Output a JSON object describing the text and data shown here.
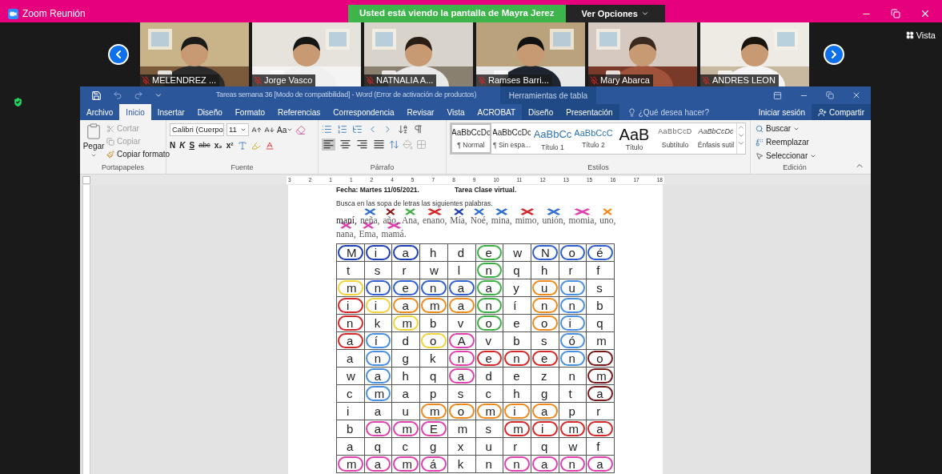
{
  "zoom": {
    "title": "Zoom Reunión",
    "banner": "Usted está viendo la pantalla de Mayra Jerez",
    "view_options": "Ver Opciones",
    "view_button": "Vista"
  },
  "participants": [
    {
      "name": "MELENDREZ ...",
      "muted": true
    },
    {
      "name": "Jorge Vasco",
      "muted": true
    },
    {
      "name": "NATNALIA A...",
      "muted": true
    },
    {
      "name": "Ramses Barri...",
      "muted": true
    },
    {
      "name": "Mary Abarca",
      "muted": true
    },
    {
      "name": "ANDRES LEON",
      "muted": true
    }
  ],
  "word": {
    "title": "Tareas semana 36 [Modo de compatibilidad] - Word (Error de activación de productos)",
    "context_group": "Herramientas de tabla",
    "tabs": [
      {
        "label": "Archivo",
        "selected": false,
        "kind": "main"
      },
      {
        "label": "Inicio",
        "selected": true,
        "kind": "main"
      },
      {
        "label": "Insertar",
        "selected": false,
        "kind": "main"
      },
      {
        "label": "Diseño",
        "selected": false,
        "kind": "main"
      },
      {
        "label": "Formato",
        "selected": false,
        "kind": "main"
      },
      {
        "label": "Referencias",
        "selected": false,
        "kind": "main"
      },
      {
        "label": "Correspondencia",
        "selected": false,
        "kind": "main"
      },
      {
        "label": "Revisar",
        "selected": false,
        "kind": "main"
      },
      {
        "label": "Vista",
        "selected": false,
        "kind": "main"
      },
      {
        "label": "ACROBAT",
        "selected": false,
        "kind": "main"
      },
      {
        "label": "Diseño",
        "selected": false,
        "kind": "context"
      },
      {
        "label": "Presentación",
        "selected": false,
        "kind": "context"
      }
    ],
    "tell_me": "¿Qué desea hacer?",
    "sign_in": "Iniciar sesión",
    "share": "Compartir",
    "clipboard": {
      "group": "Portapapeles",
      "paste": "Pegar",
      "cut": {
        "label": "Cortar",
        "disabled": true
      },
      "copy": {
        "label": "Copiar",
        "disabled": true
      },
      "format_painter": {
        "label": "Copiar formato",
        "disabled": false
      }
    },
    "font": {
      "group": "Fuente",
      "name": "Calibri (Cuerpo",
      "size": "11",
      "change_case": "Aa",
      "bold": "N",
      "italic": "K",
      "underline": "S",
      "strikethrough": "abc",
      "subscript": "x₂",
      "superscript": "x²"
    },
    "paragraph": {
      "group": "Párrafo",
      "alignments": [
        {
          "kind": "left",
          "selected": true
        },
        {
          "kind": "center",
          "selected": false
        },
        {
          "kind": "right",
          "selected": false
        },
        {
          "kind": "justify",
          "selected": false
        }
      ]
    },
    "styles": {
      "group": "Estilos",
      "items": [
        {
          "sample": "AaBbCcDc",
          "label": "¶ Normal",
          "kind": "normal",
          "selected": true
        },
        {
          "sample": "AaBbCcDc",
          "label": "¶ Sin espa...",
          "kind": "normal",
          "selected": false
        },
        {
          "sample": "AaBbCc",
          "label": "Título 1",
          "kind": "heading1",
          "selected": false
        },
        {
          "sample": "AaBbCcC",
          "label": "Título 2",
          "kind": "heading2",
          "selected": false
        },
        {
          "sample": "AaB",
          "label": "Título",
          "kind": "title",
          "selected": false
        },
        {
          "sample": "AaBbCcD",
          "label": "Subtítulo",
          "kind": "subtitle",
          "selected": false
        },
        {
          "sample": "AaBbCcDc",
          "label": "Énfasis sutil",
          "kind": "emphasis",
          "selected": false
        }
      ]
    },
    "editing": {
      "group": "Edición",
      "find": "Buscar",
      "replace": "Reemplazar",
      "select": "Seleccionar"
    },
    "ruler": [
      "3",
      "2",
      "1",
      "1",
      "2",
      "4",
      "5",
      "7",
      "8",
      "9",
      "10",
      "11",
      "12",
      "13",
      "15",
      "16",
      "17",
      "18"
    ],
    "document": {
      "date": "Fecha: Martes 11/05/2021.",
      "task": "Tarea Clase virtual.",
      "instruction": "Busca en las sopa de letras las siguientes palabras.",
      "word_lines": [
        [
          {
            "text": "maní,",
            "crossed": false
          },
          {
            "text": "neña,",
            "crossed": true,
            "color": "#2f6fd6"
          },
          {
            "text": "año,",
            "crossed": true,
            "color": "#8b1a1a"
          },
          {
            "text": "Ana,",
            "crossed": true,
            "color": "#3cb043"
          },
          {
            "text": "enano,",
            "crossed": true,
            "color": "#d62828"
          },
          {
            "text": "Mía,",
            "crossed": true,
            "color": "#1d3fb8"
          },
          {
            "text": "Noé,",
            "crossed": true,
            "color": "#2f6fd6"
          },
          {
            "text": "mina,",
            "crossed": true,
            "color": "#2f6fd6"
          },
          {
            "text": "mimo,",
            "crossed": true,
            "color": "#d62828"
          },
          {
            "text": "unión,",
            "crossed": true,
            "color": "#2f6fd6"
          },
          {
            "text": "momia,",
            "crossed": true,
            "color": "#e040b0"
          },
          {
            "text": "uno,",
            "crossed": true,
            "color": "#f08a1c"
          }
        ],
        [
          {
            "text": "nana,",
            "crossed": true,
            "color": "#e040b0"
          },
          {
            "text": "Ema,",
            "crossed": true,
            "color": "#e040b0"
          },
          {
            "text": "mamá.",
            "crossed": true,
            "color": "#e040b0"
          }
        ]
      ],
      "grid": [
        [
          {
            "letter": "M",
            "color": "#1d3fb8"
          },
          {
            "letter": "i",
            "color": "#1d3fb8"
          },
          {
            "letter": "a",
            "color": "#1d3fb8"
          },
          {
            "letter": "h"
          },
          {
            "letter": "d"
          },
          {
            "letter": "e",
            "color": "#3cb043"
          },
          {
            "letter": "w"
          },
          {
            "letter": "N",
            "color": "#2f5fd0"
          },
          {
            "letter": "o",
            "color": "#2f5fd0"
          },
          {
            "letter": "é",
            "color": "#2f5fd0"
          }
        ],
        [
          {
            "letter": "t"
          },
          {
            "letter": "s"
          },
          {
            "letter": "r"
          },
          {
            "letter": "w"
          },
          {
            "letter": "l"
          },
          {
            "letter": "n",
            "color": "#3cb043"
          },
          {
            "letter": "q"
          },
          {
            "letter": "h"
          },
          {
            "letter": "r"
          },
          {
            "letter": "f"
          }
        ],
        [
          {
            "letter": "m",
            "color": "#f2d33a"
          },
          {
            "letter": "n",
            "color": "#2f5fd0"
          },
          {
            "letter": "e",
            "color": "#2f5fd0"
          },
          {
            "letter": "n",
            "color": "#2f5fd0"
          },
          {
            "letter": "a",
            "color": "#2f5fd0"
          },
          {
            "letter": "a",
            "color": "#3cb043"
          },
          {
            "letter": "y"
          },
          {
            "letter": "u",
            "color": "#f08a1c"
          },
          {
            "letter": "u",
            "color": "#4a90e2"
          },
          {
            "letter": "s"
          }
        ],
        [
          {
            "letter": "i",
            "color": "#d62828"
          },
          {
            "letter": "i",
            "color": "#f2d33a"
          },
          {
            "letter": "a",
            "color": "#f08a1c"
          },
          {
            "letter": "m",
            "color": "#f08a1c"
          },
          {
            "letter": "a",
            "color": "#f08a1c"
          },
          {
            "letter": "n",
            "color": "#3cb043"
          },
          {
            "letter": "í"
          },
          {
            "letter": "n",
            "color": "#f08a1c"
          },
          {
            "letter": "n",
            "color": "#4a90e2"
          },
          {
            "letter": "b"
          }
        ],
        [
          {
            "letter": "n",
            "color": "#d62828"
          },
          {
            "letter": "k"
          },
          {
            "letter": "m",
            "color": "#f2d33a"
          },
          {
            "letter": "b"
          },
          {
            "letter": "v"
          },
          {
            "letter": "o",
            "color": "#3cb043"
          },
          {
            "letter": "e"
          },
          {
            "letter": "o",
            "color": "#f08a1c"
          },
          {
            "letter": "i",
            "color": "#4a90e2"
          },
          {
            "letter": "q"
          }
        ],
        [
          {
            "letter": "a",
            "color": "#d62828"
          },
          {
            "letter": "í",
            "color": "#4a90e2"
          },
          {
            "letter": "d"
          },
          {
            "letter": "o",
            "color": "#f2d33a"
          },
          {
            "letter": "A",
            "color": "#e040b0"
          },
          {
            "letter": "v"
          },
          {
            "letter": "b"
          },
          {
            "letter": "s"
          },
          {
            "letter": "ó",
            "color": "#4a90e2"
          },
          {
            "letter": "m"
          }
        ],
        [
          {
            "letter": "a"
          },
          {
            "letter": "n",
            "color": "#4a90e2"
          },
          {
            "letter": "g"
          },
          {
            "letter": "k"
          },
          {
            "letter": "n",
            "color": "#e040b0"
          },
          {
            "letter": "e",
            "color": "#d62828"
          },
          {
            "letter": "n",
            "color": "#d62828"
          },
          {
            "letter": "e",
            "color": "#d62828"
          },
          {
            "letter": "n",
            "color": "#4a90e2"
          },
          {
            "letter": "o",
            "color": "#7a1a1a"
          }
        ],
        [
          {
            "letter": "w"
          },
          {
            "letter": "a",
            "color": "#4a90e2"
          },
          {
            "letter": "h"
          },
          {
            "letter": "q"
          },
          {
            "letter": "a",
            "color": "#e040b0"
          },
          {
            "letter": "d"
          },
          {
            "letter": "e"
          },
          {
            "letter": "z"
          },
          {
            "letter": "n"
          },
          {
            "letter": "m",
            "color": "#7a1a1a"
          }
        ],
        [
          {
            "letter": "c"
          },
          {
            "letter": "m",
            "color": "#4a90e2"
          },
          {
            "letter": "a"
          },
          {
            "letter": "p"
          },
          {
            "letter": "s"
          },
          {
            "letter": "c"
          },
          {
            "letter": "h"
          },
          {
            "letter": "g"
          },
          {
            "letter": "t"
          },
          {
            "letter": "a",
            "color": "#7a1a1a"
          }
        ],
        [
          {
            "letter": "i"
          },
          {
            "letter": "a"
          },
          {
            "letter": "u"
          },
          {
            "letter": "m",
            "color": "#f08a1c"
          },
          {
            "letter": "o",
            "color": "#f08a1c"
          },
          {
            "letter": "m",
            "color": "#f08a1c"
          },
          {
            "letter": "i",
            "color": "#f08a1c"
          },
          {
            "letter": "a",
            "color": "#f08a1c"
          },
          {
            "letter": "p"
          },
          {
            "letter": "r"
          }
        ],
        [
          {
            "letter": "b"
          },
          {
            "letter": "a",
            "color": "#e040b0"
          },
          {
            "letter": "m",
            "color": "#e040b0"
          },
          {
            "letter": "E",
            "color": "#e040b0"
          },
          {
            "letter": "m"
          },
          {
            "letter": "s"
          },
          {
            "letter": "m",
            "color": "#d62828"
          },
          {
            "letter": "i",
            "color": "#d62828"
          },
          {
            "letter": "m",
            "color": "#d62828"
          },
          {
            "letter": "a",
            "color": "#d62828"
          }
        ],
        [
          {
            "letter": "a"
          },
          {
            "letter": "q"
          },
          {
            "letter": "c"
          },
          {
            "letter": "g"
          },
          {
            "letter": "x"
          },
          {
            "letter": "u"
          },
          {
            "letter": "r"
          },
          {
            "letter": "q"
          },
          {
            "letter": "w"
          },
          {
            "letter": "f"
          }
        ],
        [
          {
            "letter": "m",
            "color": "#e040b0"
          },
          {
            "letter": "a",
            "color": "#e040b0"
          },
          {
            "letter": "m",
            "color": "#e040b0"
          },
          {
            "letter": "á",
            "color": "#e040b0"
          },
          {
            "letter": "k"
          },
          {
            "letter": "n"
          },
          {
            "letter": "n",
            "color": "#e040b0"
          },
          {
            "letter": "a",
            "color": "#e040b0"
          },
          {
            "letter": "n",
            "color": "#e040b0"
          },
          {
            "letter": "a",
            "color": "#e040b0"
          }
        ]
      ]
    }
  }
}
